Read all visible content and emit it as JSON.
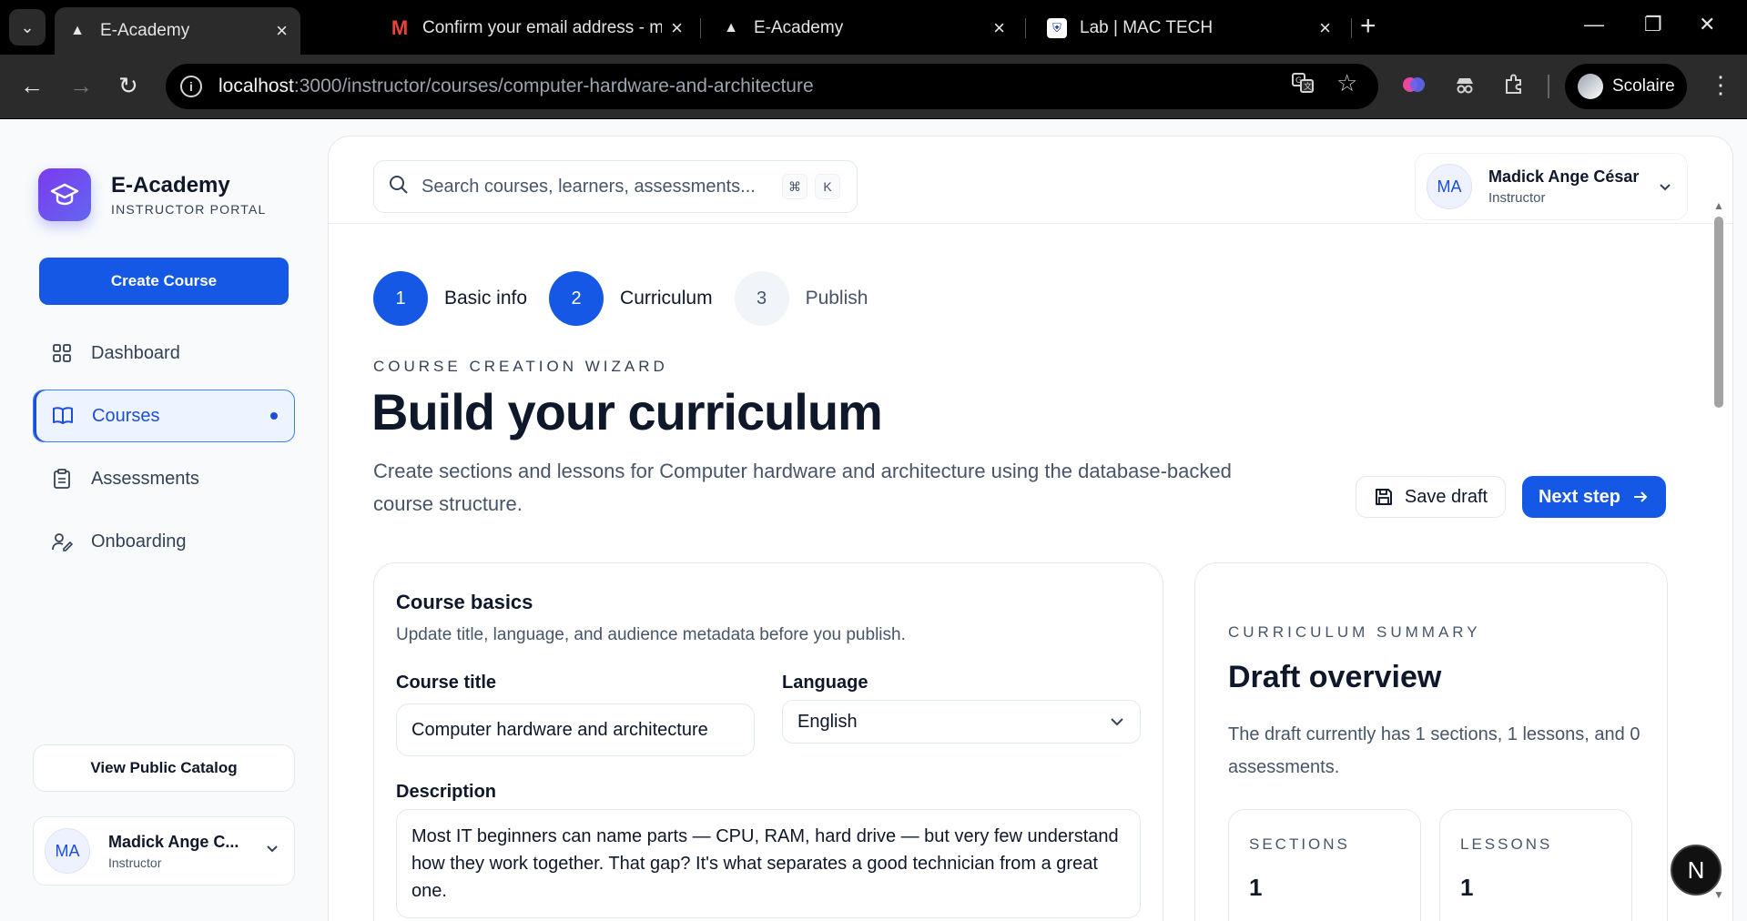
{
  "browser": {
    "tabs": [
      {
        "title": "E-Academy",
        "active": true
      },
      {
        "title": "Confirm your email address - m",
        "active": false
      },
      {
        "title": "E-Academy",
        "active": false
      },
      {
        "title": "Lab | MAC TECH",
        "active": false
      }
    ],
    "url_host": "localhost",
    "url_path": ":3000/instructor/courses/computer-hardware-and-architecture",
    "profile_name": "Scolaire"
  },
  "sidebar": {
    "brand_name": "E-Academy",
    "brand_sub": "INSTRUCTOR PORTAL",
    "create_label": "Create Course",
    "items": [
      {
        "label": "Dashboard",
        "icon": "grid-icon"
      },
      {
        "label": "Courses",
        "icon": "book-icon",
        "active": true
      },
      {
        "label": "Assessments",
        "icon": "clipboard-icon"
      },
      {
        "label": "Onboarding",
        "icon": "user-check-icon"
      }
    ],
    "public_label": "View Public Catalog",
    "user": {
      "initials": "MA",
      "name": "Madick Ange C...",
      "role": "Instructor"
    }
  },
  "topbar": {
    "search_placeholder": "Search courses, learners, assessments...",
    "kbd_cmd": "⌘",
    "kbd_key": "K",
    "user": {
      "initials": "MA",
      "name": "Madick Ange César",
      "role": "Instructor"
    }
  },
  "wizard": {
    "steps": [
      {
        "num": "1",
        "label": "Basic info",
        "state": "done"
      },
      {
        "num": "2",
        "label": "Curriculum",
        "state": "done"
      },
      {
        "num": "3",
        "label": "Publish",
        "state": "todo"
      }
    ],
    "eyebrow": "COURSE CREATION WIZARD",
    "title": "Build your curriculum",
    "description": "Create sections and lessons for Computer hardware and architecture using the database-backed course structure.",
    "save_label": "Save draft",
    "next_label": "Next step"
  },
  "basics": {
    "title": "Course basics",
    "subtitle": "Update title, language, and audience metadata before you publish.",
    "course_title_label": "Course title",
    "course_title_value": "Computer hardware and architecture",
    "language_label": "Language",
    "language_value": "English",
    "description_label": "Description",
    "description_value": "Most IT beginners can name parts — CPU, RAM, hard drive — but very few understand how they work together. That gap? It's what separates a good technician from a great one."
  },
  "summary": {
    "eyebrow": "CURRICULUM SUMMARY",
    "title": "Draft overview",
    "description": "The draft currently has 1 sections, 1 lessons, and 0 assessments.",
    "stats": [
      {
        "label": "SECTIONS",
        "value": "1"
      },
      {
        "label": "LESSONS",
        "value": "1"
      }
    ]
  },
  "dev_badge": "N",
  "colors": {
    "accent": "#1558e6",
    "brand_from": "#7c3aed",
    "brand_to": "#6366f1"
  }
}
